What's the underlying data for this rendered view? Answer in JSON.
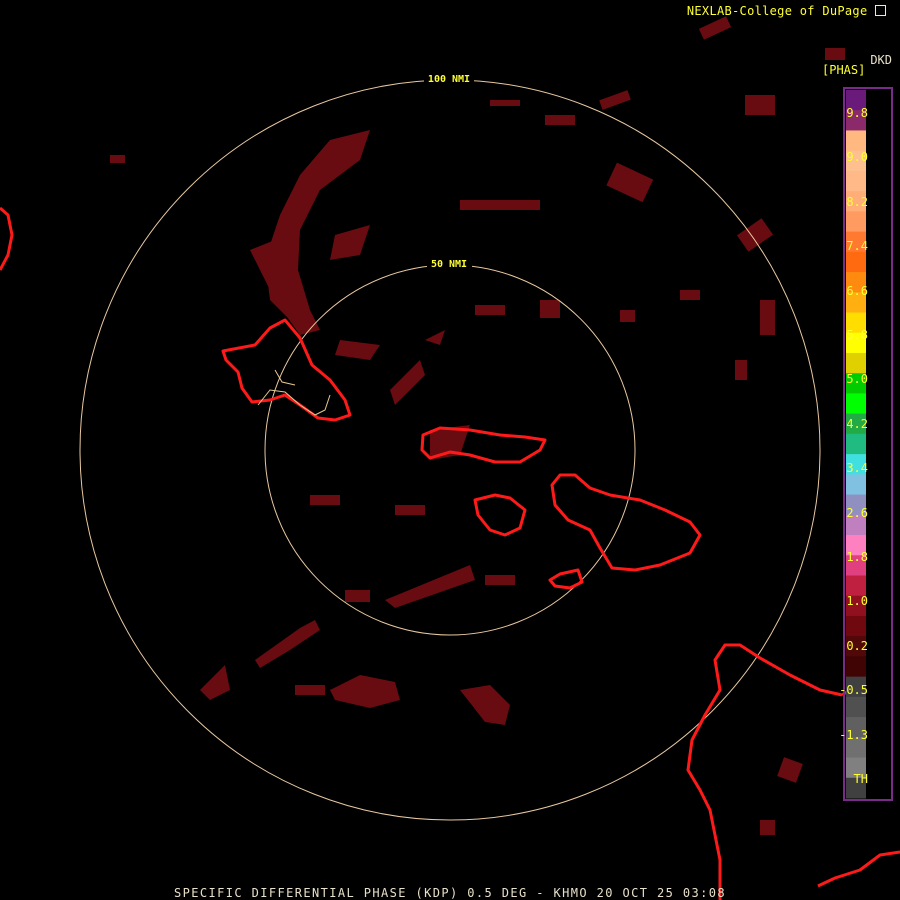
{
  "header": {
    "credit": "NEXLAB-College of DuPage",
    "credit_icon": "corner-arrow-icon"
  },
  "footer": {
    "caption": "SPECIFIC DIFFERENTIAL PHASE (KDP) 0.5 DEG - KHMO 20 OCT 25 03:08"
  },
  "range_rings": [
    {
      "label": "100 NMI"
    },
    {
      "label": "50 NMI"
    }
  ],
  "legend": {
    "code": "DKD",
    "units": "[PHAS]",
    "ticks": [
      "9.8",
      "9.0",
      "8.2",
      "7.4",
      "6.6",
      "5.8",
      "5.0",
      "4.2",
      "3.4",
      "2.6",
      "1.8",
      "1.0",
      "0.2",
      "-0.5",
      "-1.3",
      "TH"
    ],
    "colors": {
      "coastline": "#ff1a1a",
      "rings": "#e8c8a0",
      "echo": "#6e0d12",
      "text": "#ffff33"
    }
  }
}
